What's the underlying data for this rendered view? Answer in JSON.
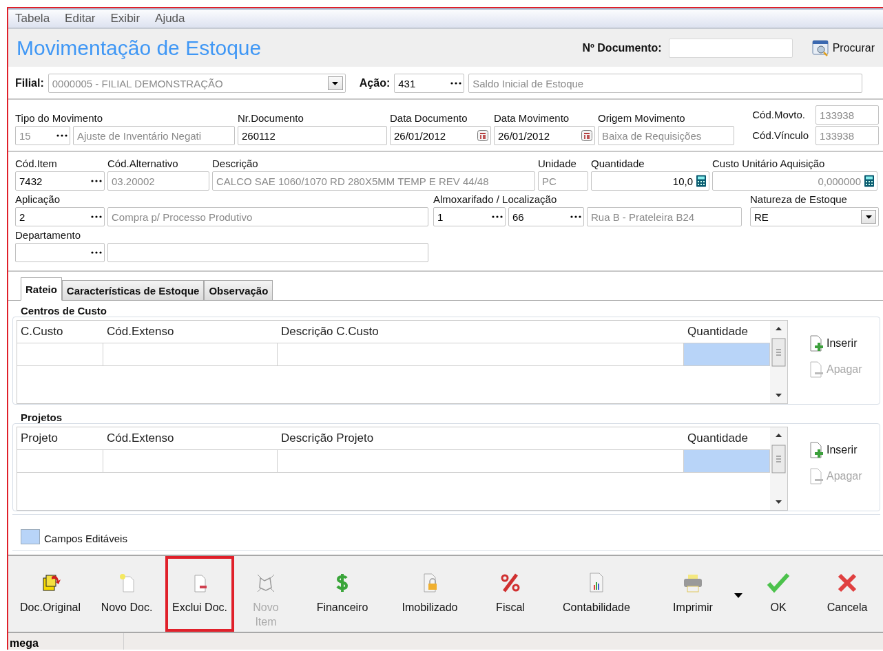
{
  "menu": [
    "Tabela",
    "Editar",
    "Exibir",
    "Ajuda"
  ],
  "title": "Movimentação de Estoque",
  "search": {
    "label": "Nº Documento:",
    "button": "Procurar"
  },
  "filial": {
    "label": "Filial:",
    "value": "0000005 - FILIAL DEMONSTRAÇÃO",
    "disabled": true
  },
  "acao": {
    "label": "Ação:",
    "code": "431",
    "description": "Saldo Inicial de Estoque",
    "disabled": true
  },
  "movement": {
    "groups": [
      {
        "label": "Tipo do Movimento",
        "inputs": [
          {
            "kind": "lookup",
            "value": "15",
            "disabled": true
          },
          {
            "kind": "text",
            "value": "Ajuste de Inventário Negati",
            "disabled": true
          }
        ]
      },
      {
        "label": "Nr.Documento",
        "inputs": [
          {
            "kind": "text",
            "value": "260112",
            "disabled": false
          }
        ]
      },
      {
        "label": "Data Documento",
        "inputs": [
          {
            "kind": "date",
            "value": "26/01/2012",
            "disabled": false
          }
        ]
      },
      {
        "label": "Data Movimento",
        "inputs": [
          {
            "kind": "date",
            "value": "26/01/2012",
            "disabled": false
          }
        ]
      },
      {
        "label": "Origem Movimento",
        "inputs": [
          {
            "kind": "text",
            "value": "Baixa de Requisições",
            "disabled": true
          }
        ]
      }
    ],
    "codes": [
      {
        "label": "Cód.Movto.",
        "value": "133938",
        "disabled": true
      },
      {
        "label": "Cód.Vínculo",
        "value": "133938",
        "disabled": true
      }
    ]
  },
  "item": {
    "rows": [
      {
        "groups": [
          {
            "label": "Cód.Item",
            "inputs": [
              {
                "kind": "lookup",
                "value": "7432",
                "disabled": false
              }
            ]
          },
          {
            "label": "Cód.Alternativo",
            "inputs": [
              {
                "kind": "text",
                "value": "03.20002",
                "disabled": true
              }
            ]
          },
          {
            "label": "Descrição",
            "inputs": [
              {
                "kind": "text",
                "value": "CALCO SAE 1060/1070 RD 280X5MM TEMP E REV 44/48",
                "disabled": true
              }
            ]
          },
          {
            "label": "Unidade",
            "inputs": [
              {
                "kind": "text",
                "value": "PC",
                "disabled": true
              }
            ]
          },
          {
            "label": "Quantidade",
            "inputs": [
              {
                "kind": "calc",
                "value": "10,0",
                "disabled": false
              }
            ]
          },
          {
            "label": "Custo Unitário Aquisição",
            "inputs": [
              {
                "kind": "calc",
                "value": "0,000000",
                "disabled": true
              }
            ]
          }
        ]
      },
      {
        "groups": [
          {
            "label": "Aplicação",
            "inputs": [
              {
                "kind": "lookup",
                "value": "2",
                "disabled": false
              },
              {
                "kind": "text",
                "value": "Compra p/ Processo Produtivo",
                "disabled": true
              }
            ]
          },
          {
            "label": "Almoxarifado / Localização",
            "inputs": [
              {
                "kind": "lookup",
                "value": "1",
                "disabled": false
              },
              {
                "kind": "lookup",
                "value": "66",
                "disabled": false
              },
              {
                "kind": "text",
                "value": "Rua B - Prateleira B24",
                "disabled": true
              }
            ]
          },
          {
            "label": "Natureza de Estoque",
            "inputs": [
              {
                "kind": "combo",
                "value": "RE",
                "disabled": false
              }
            ]
          }
        ]
      },
      {
        "groups": [
          {
            "label": "Departamento",
            "inputs": [
              {
                "kind": "lookup"
              },
              {
                "kind": "text"
              }
            ]
          }
        ]
      }
    ]
  },
  "tabs": [
    {
      "label": "Rateio",
      "selected": true
    },
    {
      "label": "Características de Estoque",
      "selected": false
    },
    {
      "label": "Observação",
      "selected": false
    }
  ],
  "grids": [
    {
      "title": "Centros de Custo",
      "columns": [
        {
          "label": "C.Custo",
          "editable": false
        },
        {
          "label": "Cód.Extenso",
          "editable": false
        },
        {
          "label": "Descrição C.Custo",
          "editable": false
        },
        {
          "label": "Quantidade",
          "editable": true
        }
      ],
      "actions": [
        {
          "label": "Inserir",
          "disabled": false
        },
        {
          "label": "Apagar",
          "disabled": true
        }
      ]
    },
    {
      "title": "Projetos",
      "columns": [
        {
          "label": "Projeto",
          "editable": false
        },
        {
          "label": "Cód.Extenso",
          "editable": false
        },
        {
          "label": "Descrição Projeto",
          "editable": false
        },
        {
          "label": "Quantidade",
          "editable": true
        }
      ],
      "actions": [
        {
          "label": "Inserir",
          "disabled": false
        },
        {
          "label": "Apagar",
          "disabled": true
        }
      ]
    }
  ],
  "legend": "Campos Editáveis",
  "toolbar": [
    {
      "kind": "original",
      "label": "Doc.Original",
      "disabled": false,
      "highlighted": false,
      "menu": false
    },
    {
      "kind": "new",
      "label": "Novo Doc.",
      "disabled": false,
      "highlighted": false,
      "menu": false
    },
    {
      "kind": "delete",
      "label": "Exclui Doc.",
      "disabled": false,
      "highlighted": true,
      "menu": false
    },
    {
      "kind": "newitem",
      "label": "Novo\nItem",
      "disabled": true,
      "highlighted": false,
      "menu": false
    },
    {
      "kind": "money",
      "label": "Financeiro",
      "disabled": false,
      "highlighted": false,
      "menu": false
    },
    {
      "kind": "asset",
      "label": "Imobilizado",
      "disabled": false,
      "highlighted": false,
      "menu": false
    },
    {
      "kind": "tax",
      "label": "Fiscal",
      "disabled": false,
      "highlighted": false,
      "menu": false
    },
    {
      "kind": "accounting",
      "label": "Contabilidade",
      "disabled": false,
      "highlighted": false,
      "menu": false
    },
    {
      "kind": "print",
      "label": "Imprimir",
      "disabled": false,
      "highlighted": false,
      "menu": true
    },
    {
      "kind": "ok",
      "label": "OK",
      "disabled": false,
      "highlighted": false,
      "menu": false
    },
    {
      "kind": "cancel",
      "label": "Cancela",
      "disabled": false,
      "highlighted": false,
      "menu": false
    }
  ],
  "status_bar": [
    "mega"
  ]
}
